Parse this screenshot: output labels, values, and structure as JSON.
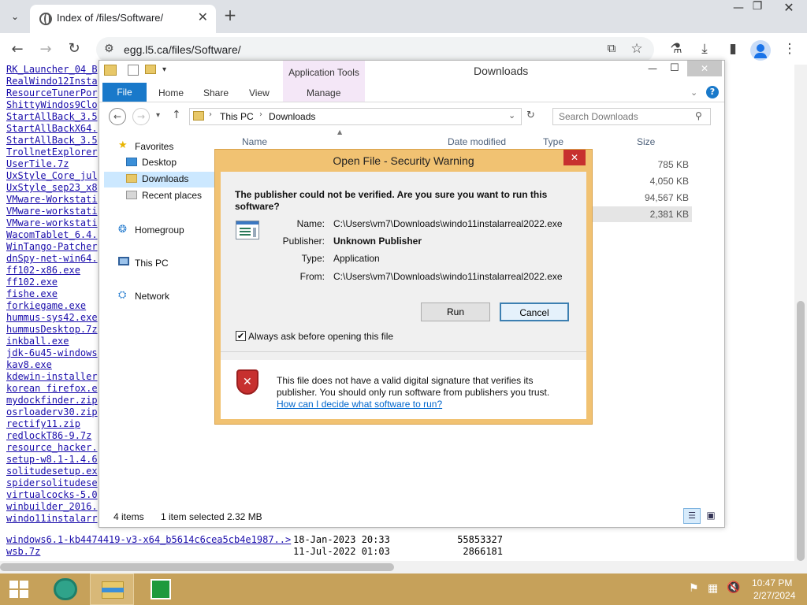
{
  "browser": {
    "tab_title": "Index of /files/Software/",
    "url": "egg.l5.ca/files/Software/",
    "close_tab": "✕",
    "new_tab": "+"
  },
  "listing": {
    "visible_names": [
      "RK_Launcher_04_B",
      "RealWindo12Insta",
      "ResourceTunerPor",
      "ShittyWindos9Clo",
      "StartAllBack_3.5",
      "StartAllBackX64.",
      "StartAllBack_3.5",
      "TrollnetExplorer",
      "UserTile.7z",
      "UxStyle_Core_jul",
      "UxStyle_sep23_x8",
      "VMware-Workstati",
      "VMware-workstati",
      "VMware-workstati",
      "WacomTablet_6.4.",
      "WinTango-Patcher",
      "dnSpy-net-win64.",
      "ff102-x86.exe",
      "ff102.exe",
      "fishe.exe",
      "forkiegame.exe",
      "hummus-sys42.exe",
      "hummusDesktop.7z",
      "inkball.exe",
      "jdk-6u45-windows",
      "kav8.exe",
      "kdewin-installer",
      "korean firefox.e",
      "mydockfinder.zip",
      "osrloaderv30.zip",
      "rectify11.zip",
      "redlockT86-9.7z",
      "resource_hacker.",
      "setup-w8.1-1.4.6",
      "solitudesetup.ex",
      "spidersolitudese",
      "virtualcocks-5.0",
      "winbuilder_2016.",
      "windo11instalarr"
    ],
    "full_rows": [
      {
        "name": "windows6.1-kb4474419-v3-x64_b5614c6cea5cb4e1987..>",
        "date": "18-Jan-2023 20:33",
        "size": "55853327"
      },
      {
        "name": "wsb.7z",
        "date": "11-Jul-2022 01:03",
        "size": "2866181"
      }
    ]
  },
  "explorer": {
    "window_title": "Downloads",
    "app_tools": "Application Tools",
    "tabs": {
      "file": "File",
      "home": "Home",
      "share": "Share",
      "view": "View",
      "manage": "Manage"
    },
    "breadcrumb": [
      "This PC",
      "Downloads"
    ],
    "search_placeholder": "Search Downloads",
    "columns": {
      "name": "Name",
      "date": "Date modified",
      "type": "Type",
      "size": "Size"
    },
    "sizes": [
      "785 KB",
      "4,050 KB",
      "94,567 KB",
      "2,381 KB"
    ],
    "nav": {
      "favorites": "Favorites",
      "desktop": "Desktop",
      "downloads": "Downloads",
      "recent": "Recent places",
      "homegroup": "Homegroup",
      "thispc": "This PC",
      "network": "Network"
    },
    "status": {
      "items": "4 items",
      "selected": "1 item selected",
      "size": "2.32 MB"
    }
  },
  "dialog": {
    "title": "Open File - Security Warning",
    "close": "✕",
    "question": "The publisher could not be verified.  Are you sure you want to run this software?",
    "name_label": "Name:",
    "name_value": "C:\\Users\\vm7\\Downloads\\windo11instalarreal2022.exe",
    "publisher_label": "Publisher:",
    "publisher_value": "Unknown Publisher",
    "type_label": "Type:",
    "type_value": "Application",
    "from_label": "From:",
    "from_value": "C:\\Users\\vm7\\Downloads\\windo11instalarreal2022.exe",
    "run": "Run",
    "cancel": "Cancel",
    "checkbox_label": "Always ask before opening this file",
    "checkbox_checked": true,
    "warning_text": "This file does not have a valid digital signature that verifies its publisher.  You should only run software from publishers you trust.",
    "help_link": "How can I decide what software to run?"
  },
  "taskbar": {
    "time": "10:47 PM",
    "date": "2/27/2024"
  },
  "colors": {
    "taskbar": "#c6a15a",
    "dialog_frame": "#f1c272",
    "file_tab": "#1979ca",
    "close_red": "#c7302f",
    "link": "#1a0dab"
  }
}
